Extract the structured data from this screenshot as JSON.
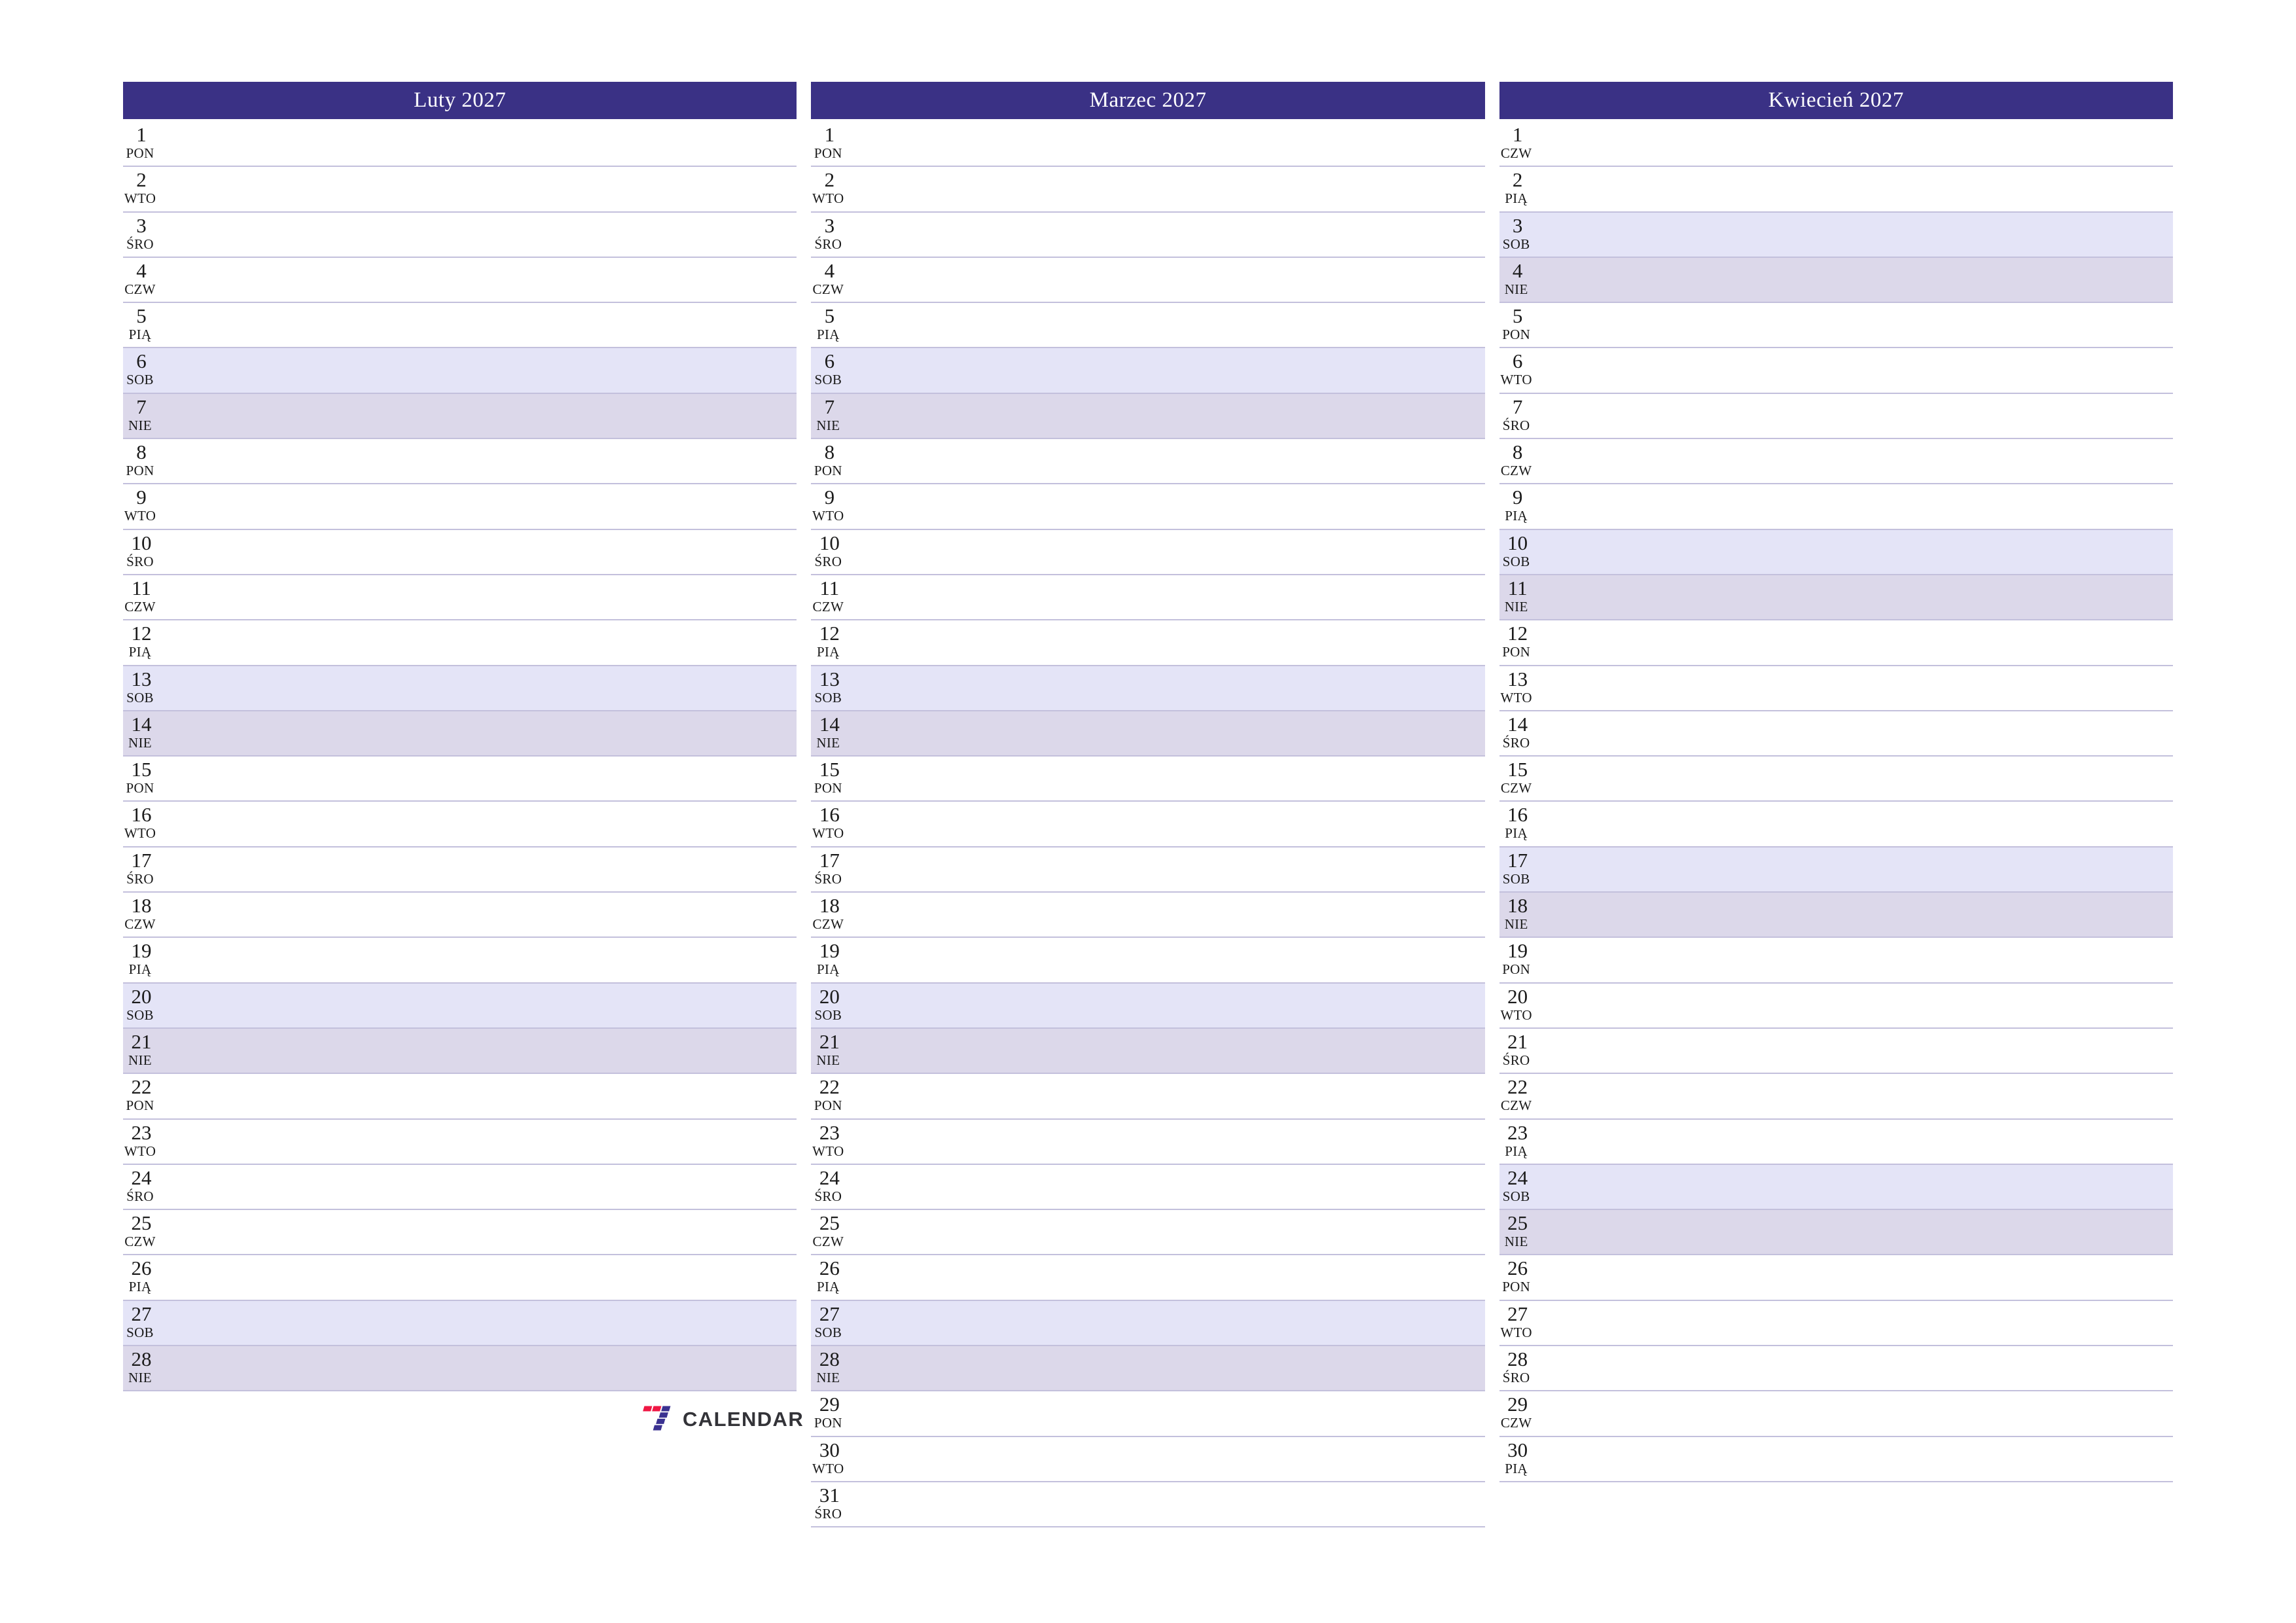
{
  "page": {
    "title": "Kalendarz planer 2027",
    "language": "pl",
    "colors": {
      "header_background": "#3a3185",
      "header_text": "#ffffff",
      "saturday_background": "#e4e4f7",
      "sunday_background": "#dcd8ea",
      "row_separator": "#c3c0dc",
      "page_background": "#ffffff",
      "day_text": "#1a1a1a",
      "logo_red": "#ef1744",
      "logo_indigo": "#3a3191",
      "logo_wordmark": "#333338"
    }
  },
  "weekday_abbreviations": {
    "monday": "PON",
    "tuesday": "WTO",
    "wednesday": "ŚRO",
    "thursday": "CZW",
    "friday": "PIĄ",
    "saturday": "SOB",
    "sunday": "NIE"
  },
  "months": [
    {
      "title": "Luty 2027",
      "name": "Luty",
      "year": "2027",
      "day_count": 28,
      "days": [
        {
          "num": "1",
          "abbr": "PON",
          "type": "weekday"
        },
        {
          "num": "2",
          "abbr": "WTO",
          "type": "weekday"
        },
        {
          "num": "3",
          "abbr": "ŚRO",
          "type": "weekday"
        },
        {
          "num": "4",
          "abbr": "CZW",
          "type": "weekday"
        },
        {
          "num": "5",
          "abbr": "PIĄ",
          "type": "weekday"
        },
        {
          "num": "6",
          "abbr": "SOB",
          "type": "saturday"
        },
        {
          "num": "7",
          "abbr": "NIE",
          "type": "sunday"
        },
        {
          "num": "8",
          "abbr": "PON",
          "type": "weekday"
        },
        {
          "num": "9",
          "abbr": "WTO",
          "type": "weekday"
        },
        {
          "num": "10",
          "abbr": "ŚRO",
          "type": "weekday"
        },
        {
          "num": "11",
          "abbr": "CZW",
          "type": "weekday"
        },
        {
          "num": "12",
          "abbr": "PIĄ",
          "type": "weekday"
        },
        {
          "num": "13",
          "abbr": "SOB",
          "type": "saturday"
        },
        {
          "num": "14",
          "abbr": "NIE",
          "type": "sunday"
        },
        {
          "num": "15",
          "abbr": "PON",
          "type": "weekday"
        },
        {
          "num": "16",
          "abbr": "WTO",
          "type": "weekday"
        },
        {
          "num": "17",
          "abbr": "ŚRO",
          "type": "weekday"
        },
        {
          "num": "18",
          "abbr": "CZW",
          "type": "weekday"
        },
        {
          "num": "19",
          "abbr": "PIĄ",
          "type": "weekday"
        },
        {
          "num": "20",
          "abbr": "SOB",
          "type": "saturday"
        },
        {
          "num": "21",
          "abbr": "NIE",
          "type": "sunday"
        },
        {
          "num": "22",
          "abbr": "PON",
          "type": "weekday"
        },
        {
          "num": "23",
          "abbr": "WTO",
          "type": "weekday"
        },
        {
          "num": "24",
          "abbr": "ŚRO",
          "type": "weekday"
        },
        {
          "num": "25",
          "abbr": "CZW",
          "type": "weekday"
        },
        {
          "num": "26",
          "abbr": "PIĄ",
          "type": "weekday"
        },
        {
          "num": "27",
          "abbr": "SOB",
          "type": "saturday"
        },
        {
          "num": "28",
          "abbr": "NIE",
          "type": "sunday"
        }
      ]
    },
    {
      "title": "Marzec 2027",
      "name": "Marzec",
      "year": "2027",
      "day_count": 31,
      "days": [
        {
          "num": "1",
          "abbr": "PON",
          "type": "weekday"
        },
        {
          "num": "2",
          "abbr": "WTO",
          "type": "weekday"
        },
        {
          "num": "3",
          "abbr": "ŚRO",
          "type": "weekday"
        },
        {
          "num": "4",
          "abbr": "CZW",
          "type": "weekday"
        },
        {
          "num": "5",
          "abbr": "PIĄ",
          "type": "weekday"
        },
        {
          "num": "6",
          "abbr": "SOB",
          "type": "saturday"
        },
        {
          "num": "7",
          "abbr": "NIE",
          "type": "sunday"
        },
        {
          "num": "8",
          "abbr": "PON",
          "type": "weekday"
        },
        {
          "num": "9",
          "abbr": "WTO",
          "type": "weekday"
        },
        {
          "num": "10",
          "abbr": "ŚRO",
          "type": "weekday"
        },
        {
          "num": "11",
          "abbr": "CZW",
          "type": "weekday"
        },
        {
          "num": "12",
          "abbr": "PIĄ",
          "type": "weekday"
        },
        {
          "num": "13",
          "abbr": "SOB",
          "type": "saturday"
        },
        {
          "num": "14",
          "abbr": "NIE",
          "type": "sunday"
        },
        {
          "num": "15",
          "abbr": "PON",
          "type": "weekday"
        },
        {
          "num": "16",
          "abbr": "WTO",
          "type": "weekday"
        },
        {
          "num": "17",
          "abbr": "ŚRO",
          "type": "weekday"
        },
        {
          "num": "18",
          "abbr": "CZW",
          "type": "weekday"
        },
        {
          "num": "19",
          "abbr": "PIĄ",
          "type": "weekday"
        },
        {
          "num": "20",
          "abbr": "SOB",
          "type": "saturday"
        },
        {
          "num": "21",
          "abbr": "NIE",
          "type": "sunday"
        },
        {
          "num": "22",
          "abbr": "PON",
          "type": "weekday"
        },
        {
          "num": "23",
          "abbr": "WTO",
          "type": "weekday"
        },
        {
          "num": "24",
          "abbr": "ŚRO",
          "type": "weekday"
        },
        {
          "num": "25",
          "abbr": "CZW",
          "type": "weekday"
        },
        {
          "num": "26",
          "abbr": "PIĄ",
          "type": "weekday"
        },
        {
          "num": "27",
          "abbr": "SOB",
          "type": "saturday"
        },
        {
          "num": "28",
          "abbr": "NIE",
          "type": "sunday"
        },
        {
          "num": "29",
          "abbr": "PON",
          "type": "weekday"
        },
        {
          "num": "30",
          "abbr": "WTO",
          "type": "weekday"
        },
        {
          "num": "31",
          "abbr": "ŚRO",
          "type": "weekday"
        }
      ]
    },
    {
      "title": "Kwiecień 2027",
      "name": "Kwiecień",
      "year": "2027",
      "day_count": 30,
      "days": [
        {
          "num": "1",
          "abbr": "CZW",
          "type": "weekday"
        },
        {
          "num": "2",
          "abbr": "PIĄ",
          "type": "weekday"
        },
        {
          "num": "3",
          "abbr": "SOB",
          "type": "saturday"
        },
        {
          "num": "4",
          "abbr": "NIE",
          "type": "sunday"
        },
        {
          "num": "5",
          "abbr": "PON",
          "type": "weekday"
        },
        {
          "num": "6",
          "abbr": "WTO",
          "type": "weekday"
        },
        {
          "num": "7",
          "abbr": "ŚRO",
          "type": "weekday"
        },
        {
          "num": "8",
          "abbr": "CZW",
          "type": "weekday"
        },
        {
          "num": "9",
          "abbr": "PIĄ",
          "type": "weekday"
        },
        {
          "num": "10",
          "abbr": "SOB",
          "type": "saturday"
        },
        {
          "num": "11",
          "abbr": "NIE",
          "type": "sunday"
        },
        {
          "num": "12",
          "abbr": "PON",
          "type": "weekday"
        },
        {
          "num": "13",
          "abbr": "WTO",
          "type": "weekday"
        },
        {
          "num": "14",
          "abbr": "ŚRO",
          "type": "weekday"
        },
        {
          "num": "15",
          "abbr": "CZW",
          "type": "weekday"
        },
        {
          "num": "16",
          "abbr": "PIĄ",
          "type": "weekday"
        },
        {
          "num": "17",
          "abbr": "SOB",
          "type": "saturday"
        },
        {
          "num": "18",
          "abbr": "NIE",
          "type": "sunday"
        },
        {
          "num": "19",
          "abbr": "PON",
          "type": "weekday"
        },
        {
          "num": "20",
          "abbr": "WTO",
          "type": "weekday"
        },
        {
          "num": "21",
          "abbr": "ŚRO",
          "type": "weekday"
        },
        {
          "num": "22",
          "abbr": "CZW",
          "type": "weekday"
        },
        {
          "num": "23",
          "abbr": "PIĄ",
          "type": "weekday"
        },
        {
          "num": "24",
          "abbr": "SOB",
          "type": "saturday"
        },
        {
          "num": "25",
          "abbr": "NIE",
          "type": "sunday"
        },
        {
          "num": "26",
          "abbr": "PON",
          "type": "weekday"
        },
        {
          "num": "27",
          "abbr": "WTO",
          "type": "weekday"
        },
        {
          "num": "28",
          "abbr": "ŚRO",
          "type": "weekday"
        },
        {
          "num": "29",
          "abbr": "CZW",
          "type": "weekday"
        },
        {
          "num": "30",
          "abbr": "PIĄ",
          "type": "weekday"
        }
      ]
    }
  ],
  "logo": {
    "mark": "seven-logo-icon",
    "wordmark": "CALENDAR"
  }
}
